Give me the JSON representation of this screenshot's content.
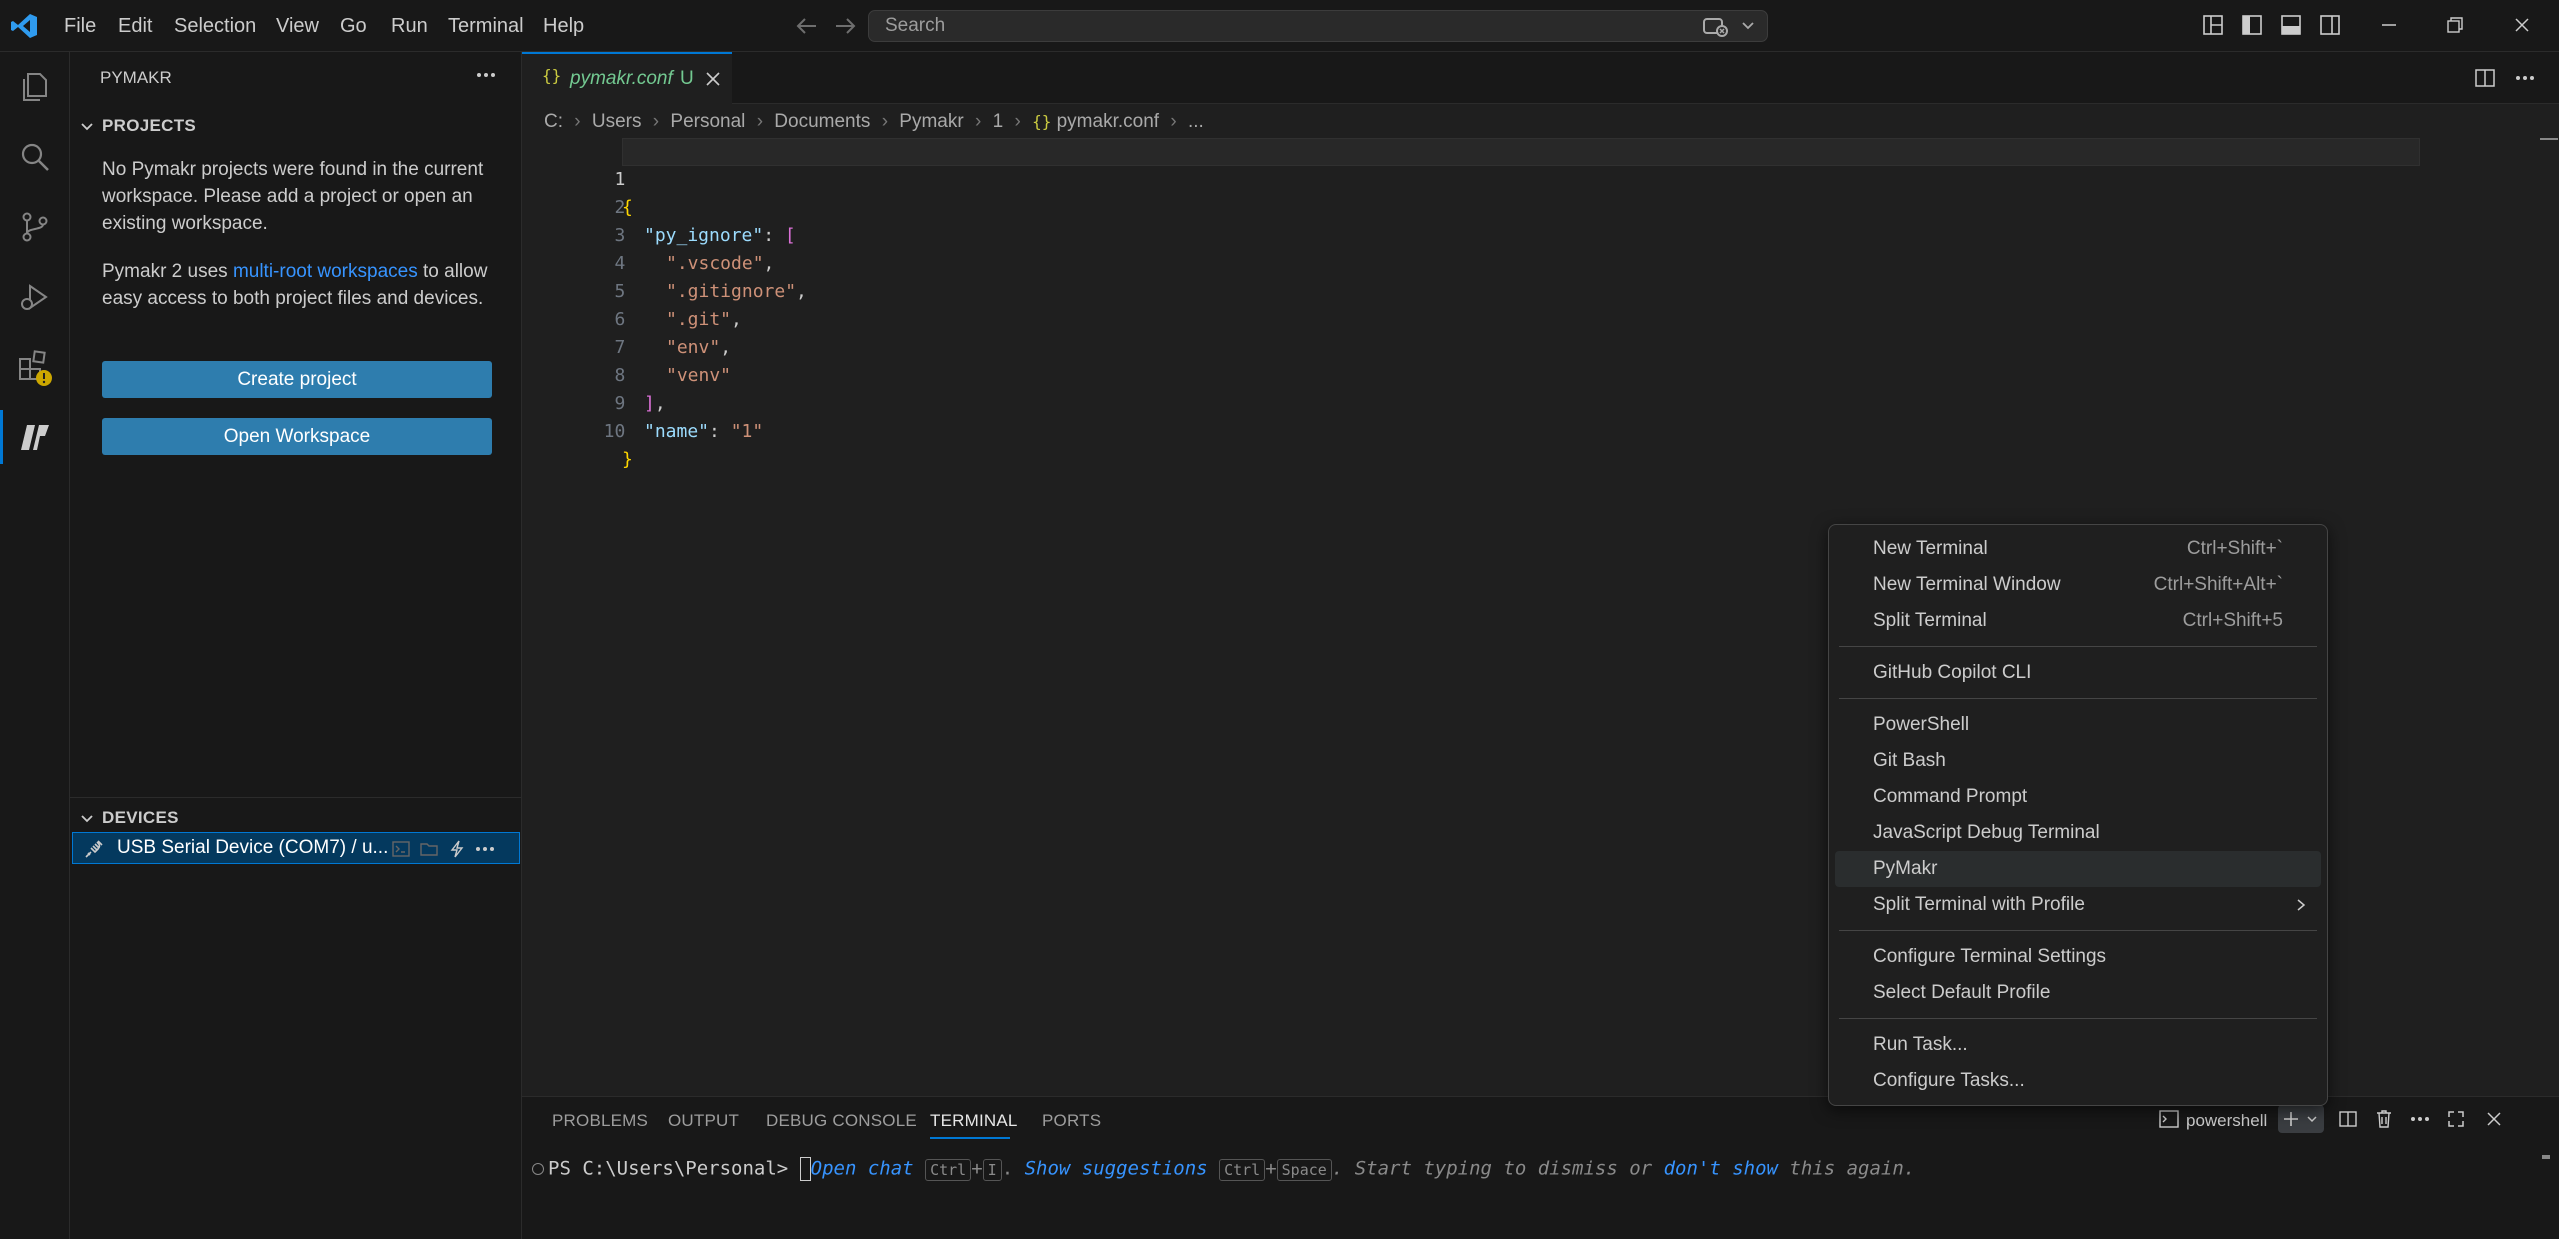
{
  "titlebar": {
    "menus": [
      "File",
      "Edit",
      "Selection",
      "View",
      "Go",
      "Run",
      "Terminal",
      "Help"
    ],
    "search_placeholder": "Search"
  },
  "sidebar": {
    "title": "PYMAKR",
    "projects_header": "PROJECTS",
    "no_projects_text": "No Pymakr projects were found in the current workspace. Please add a project or open an existing workspace.",
    "info_prefix": "Pymakr 2 uses",
    "info_link": "multi-root workspaces",
    "info_suffix": "to allow easy access to both project files and devices.",
    "create_project_label": "Create project",
    "open_workspace_label": "Open Workspace",
    "devices_header": "DEVICES",
    "device_label": "USB Serial Device (COM7) / u..."
  },
  "editor": {
    "tab": {
      "filename": "pymakr.conf",
      "status": "U"
    },
    "breadcrumb": [
      "C:",
      "Users",
      "Personal",
      "Documents",
      "Pymakr",
      "1",
      "pymakr.conf",
      "..."
    ],
    "lines": [
      "1",
      "2",
      "3",
      "4",
      "5",
      "6",
      "7",
      "8",
      "9",
      "10"
    ],
    "tokens": {
      "open_brace": "{",
      "key_py_ignore": "\"py_ignore\"",
      "colon": ":",
      "open_bracket": "[",
      "v1": "\".vscode\"",
      "v2": "\".gitignore\"",
      "v3": "\".git\"",
      "v4": "\"env\"",
      "v5": "\"venv\"",
      "comma": ",",
      "close_bracket": "]",
      "key_name": "\"name\"",
      "val_name": "\"1\"",
      "close_brace": "}"
    }
  },
  "panel": {
    "tabs": [
      "PROBLEMS",
      "OUTPUT",
      "DEBUG CONSOLE",
      "TERMINAL",
      "PORTS"
    ],
    "active_tab": "TERMINAL",
    "terminal_name": "powershell",
    "prompt": "PS C:\\Users\\Personal>",
    "hint": {
      "open_chat": "Open chat",
      "k_ctrl": "Ctrl",
      "k_plus": "+",
      "k_i": "I",
      "dot": ".",
      "show_suggestions": "Show suggestions",
      "k_space": "Space",
      "start_typing": ". Start typing to dismiss or",
      "dont_show": "don't show",
      "this_again": "this again."
    }
  },
  "context_menu": {
    "items": [
      {
        "label": "New Terminal",
        "shortcut": "Ctrl+Shift+`"
      },
      {
        "label": "New Terminal Window",
        "shortcut": "Ctrl+Shift+Alt+`"
      },
      {
        "label": "Split Terminal",
        "shortcut": "Ctrl+Shift+5"
      },
      {
        "label": "GitHub Copilot CLI",
        "shortcut": ""
      },
      {
        "label": "PowerShell",
        "shortcut": ""
      },
      {
        "label": "Git Bash",
        "shortcut": ""
      },
      {
        "label": "Command Prompt",
        "shortcut": ""
      },
      {
        "label": "JavaScript Debug Terminal",
        "shortcut": ""
      },
      {
        "label": "PyMakr",
        "shortcut": ""
      },
      {
        "label": "Split Terminal with Profile",
        "shortcut": ""
      },
      {
        "label": "Configure Terminal Settings",
        "shortcut": ""
      },
      {
        "label": "Select Default Profile",
        "shortcut": ""
      },
      {
        "label": "Run Task...",
        "shortcut": ""
      },
      {
        "label": "Configure Tasks...",
        "shortcut": ""
      }
    ]
  },
  "colors": {
    "accent": "#0078d4",
    "button": "#2e7dae",
    "link": "#3794ff"
  }
}
